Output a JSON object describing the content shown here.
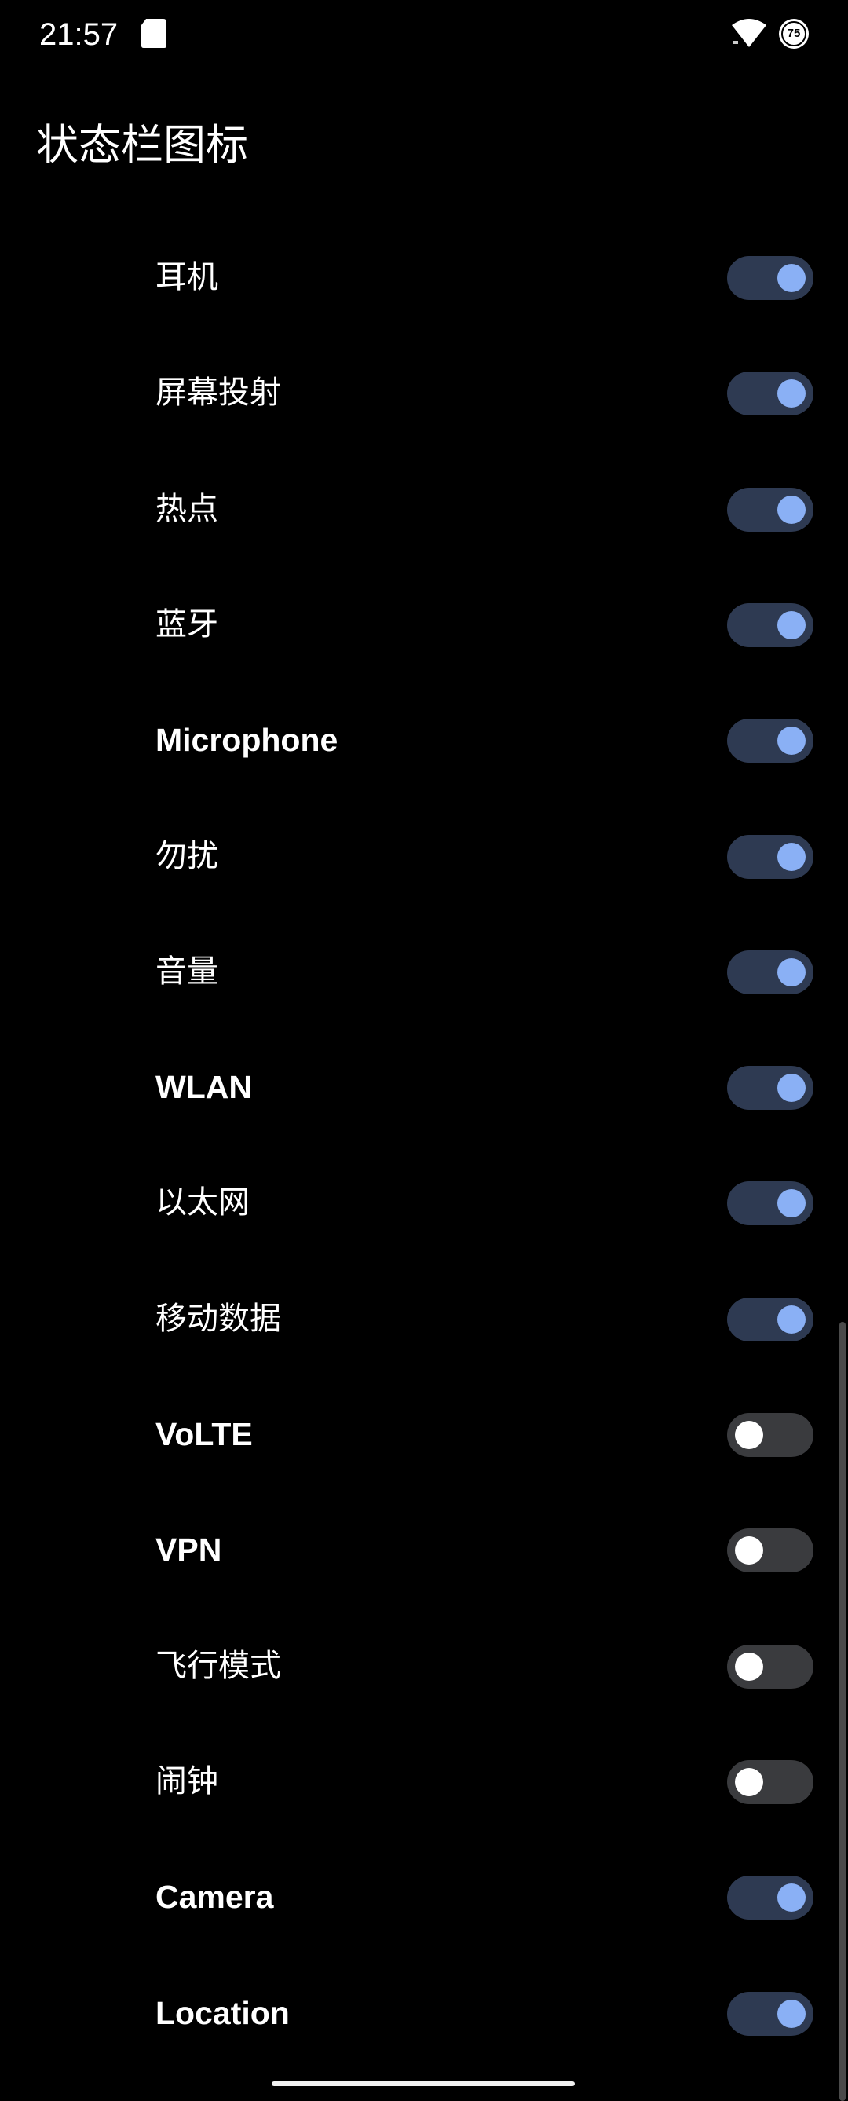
{
  "status_bar": {
    "time": "21:57",
    "icons": [
      "sd-card-icon",
      "wifi-icon",
      "battery-icon"
    ],
    "battery_level": "75"
  },
  "page": {
    "title": "状态栏图标"
  },
  "colors": {
    "background": "#000000",
    "switch_on_track": "#2e3a52",
    "switch_on_knob": "#8ab0f5",
    "switch_off_track": "#3a3b3e",
    "switch_off_knob": "#ffffff"
  },
  "items": [
    {
      "label": "耳机",
      "on": true
    },
    {
      "label": "屏幕投射",
      "on": true
    },
    {
      "label": "热点",
      "on": true
    },
    {
      "label": "蓝牙",
      "on": true
    },
    {
      "label": "Microphone",
      "on": true
    },
    {
      "label": "勿扰",
      "on": true
    },
    {
      "label": "音量",
      "on": true
    },
    {
      "label": "WLAN",
      "on": true
    },
    {
      "label": "以太网",
      "on": true
    },
    {
      "label": "移动数据",
      "on": true
    },
    {
      "label": "VoLTE",
      "on": false
    },
    {
      "label": "VPN",
      "on": false
    },
    {
      "label": "飞行模式",
      "on": false
    },
    {
      "label": "闹钟",
      "on": false
    },
    {
      "label": "Camera",
      "on": true
    },
    {
      "label": "Location",
      "on": true
    }
  ]
}
